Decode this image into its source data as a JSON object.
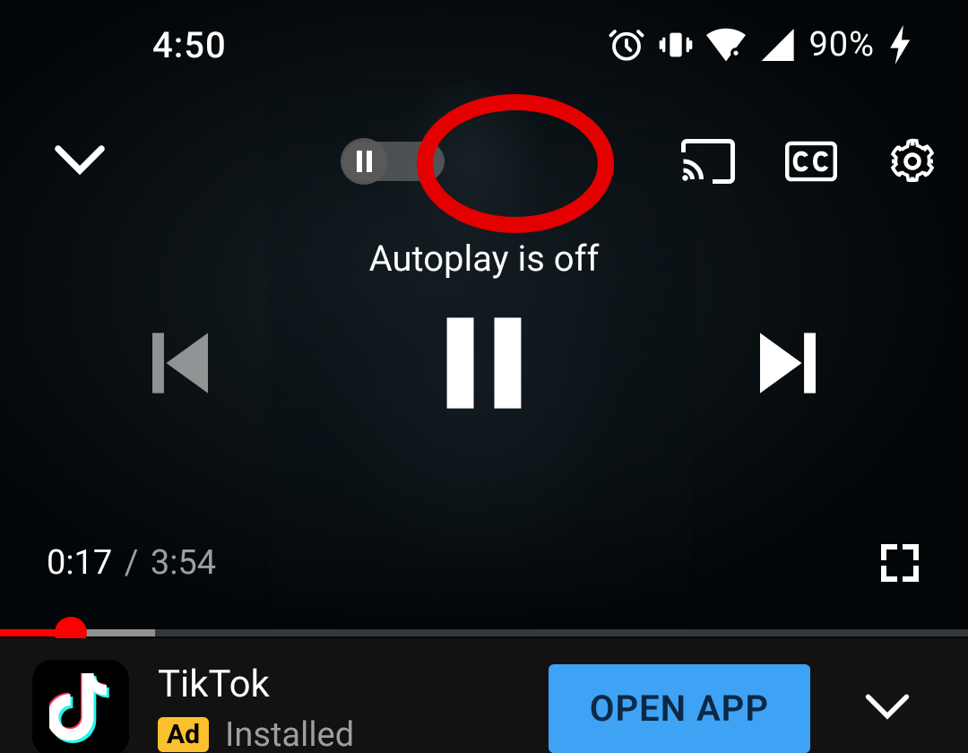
{
  "status": {
    "time": "4:50",
    "battery_pct": "90%",
    "icons": [
      "alarm",
      "vibrate",
      "wifi",
      "cell",
      "bolt"
    ]
  },
  "player": {
    "autoplay_state": "off",
    "autoplay_label": "Autoplay is off",
    "annotation_target": "autoplay-toggle",
    "time_current": "0:17",
    "time_total": "3:54",
    "progress_played_pct": 7.3,
    "progress_buffered_pct": 16
  },
  "top_icons": {
    "collapse": "chevron-down",
    "cast": "cast",
    "cc": "CC",
    "settings": "gear"
  },
  "ad": {
    "app_name": "TikTok",
    "badge": "Ad",
    "install_status": "Installed",
    "cta": "OPEN APP"
  },
  "colors": {
    "accent_red": "#ff0000",
    "annotation": "#e40000",
    "ad_badge": "#fbc02d",
    "open_btn": "#3ea3f5"
  }
}
